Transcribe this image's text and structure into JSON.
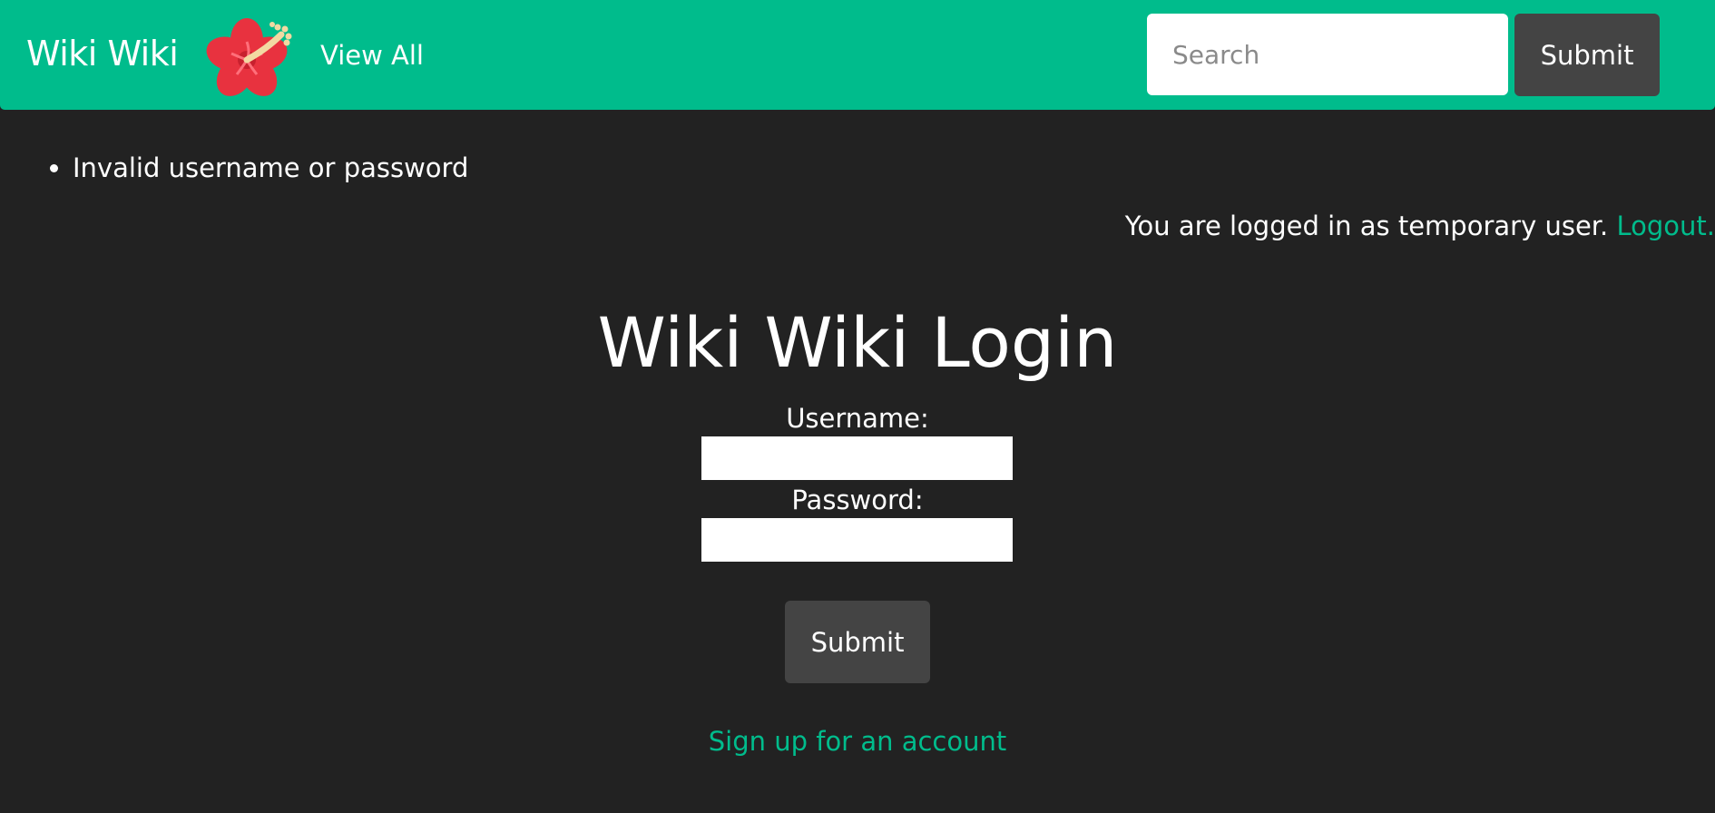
{
  "header": {
    "brand": "Wiki Wiki",
    "logo_icon": "hibiscus-flower-icon",
    "view_all_label": "View All",
    "search": {
      "placeholder": "Search",
      "value": ""
    },
    "submit_label": "Submit"
  },
  "messages": [
    "Invalid username or password"
  ],
  "status": {
    "prefix": "You are logged in as temporary user.",
    "logout_label": "Logout."
  },
  "login_form": {
    "title": "Wiki Wiki Login",
    "username_label": "Username:",
    "username_value": "",
    "password_label": "Password:",
    "password_value": "",
    "submit_label": "Submit",
    "signup_label": "Sign up for an account"
  },
  "colors": {
    "accent": "#00bc8c",
    "background": "#222222",
    "button": "#444444",
    "flower_petal": "#e8323f",
    "flower_stamen": "#f2d9a2"
  }
}
